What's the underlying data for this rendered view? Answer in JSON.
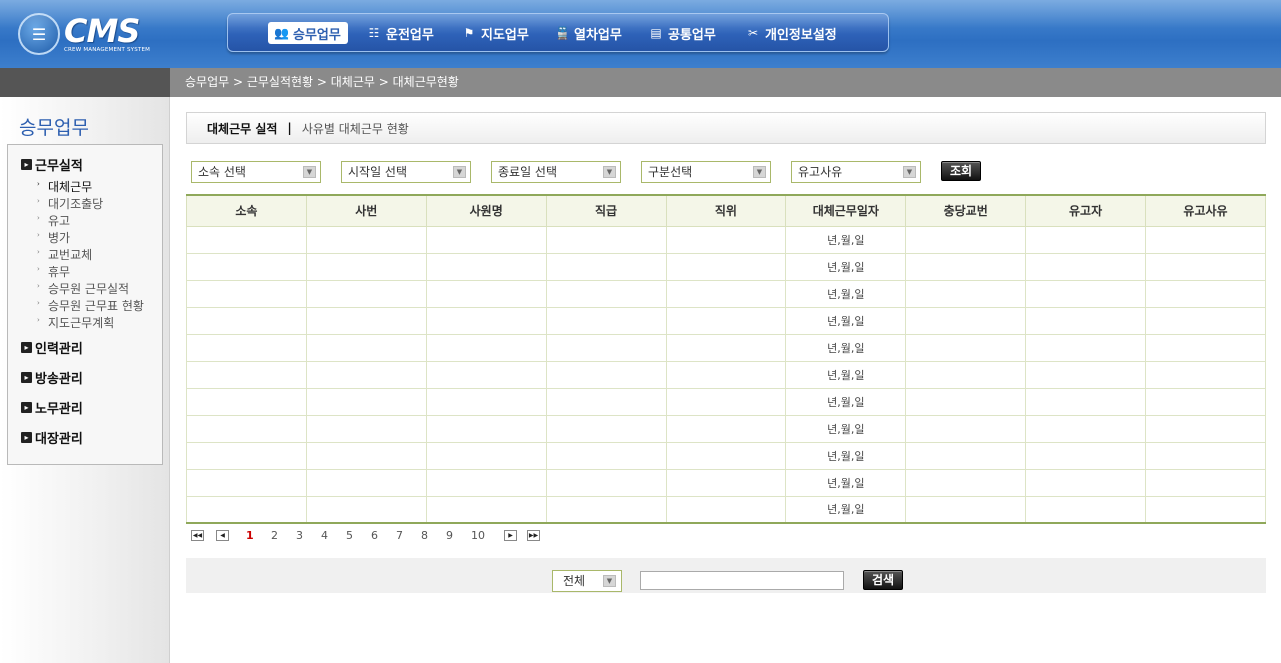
{
  "logo": {
    "badge": "☰",
    "main": "CMS",
    "sub": "CREW MANAGEMENT SYSTEM"
  },
  "topnav": [
    {
      "label": "승무업무",
      "icon": "crew-icon",
      "glyph": "👥",
      "active": true
    },
    {
      "label": "운전업무",
      "icon": "track-icon",
      "glyph": "☷",
      "active": false
    },
    {
      "label": "지도업무",
      "icon": "flag-icon",
      "glyph": "⚑",
      "active": false
    },
    {
      "label": "열차업무",
      "icon": "train-icon",
      "glyph": "🚆",
      "active": false
    },
    {
      "label": "공통업무",
      "icon": "document-icon",
      "glyph": "▤",
      "active": false
    },
    {
      "label": "개인정보설정",
      "icon": "tools-icon",
      "glyph": "✂",
      "active": false
    }
  ],
  "breadcrumb": "승무업무 > 근무실적현황 > 대체근무 > 대체근무현황",
  "sidebar": {
    "title": "승무업무",
    "sections": [
      {
        "label": "근무실적",
        "items": [
          "대체근무",
          "대기조출당",
          "유고",
          "병가",
          "교번교체",
          "휴무",
          "승무원 근무실적",
          "승무원 근무표 현황",
          "지도근무계획"
        ]
      },
      {
        "label": "인력관리"
      },
      {
        "label": "방송관리"
      },
      {
        "label": "노무관리"
      },
      {
        "label": "대장관리"
      }
    ],
    "current_item": "대체근무"
  },
  "page_header": {
    "title": "대체근무 실적",
    "separator": "|",
    "subtitle": "사유별 대체근무 현황"
  },
  "filters": {
    "affiliation": "소속 선택",
    "start_date": "시작일 선택",
    "end_date": "종료일 선택",
    "category": "구분선택",
    "reason": "유고사유",
    "submit_label": "조회"
  },
  "table": {
    "columns": [
      "소속",
      "사번",
      "사원명",
      "직급",
      "직위",
      "대체근무일자",
      "충당교번",
      "유고자",
      "유고사유"
    ],
    "rows": [
      [
        "",
        "",
        "",
        "",
        "",
        "년,월,일",
        "",
        "",
        ""
      ],
      [
        "",
        "",
        "",
        "",
        "",
        "년,월,일",
        "",
        "",
        ""
      ],
      [
        "",
        "",
        "",
        "",
        "",
        "년,월,일",
        "",
        "",
        ""
      ],
      [
        "",
        "",
        "",
        "",
        "",
        "년,월,일",
        "",
        "",
        ""
      ],
      [
        "",
        "",
        "",
        "",
        "",
        "년,월,일",
        "",
        "",
        ""
      ],
      [
        "",
        "",
        "",
        "",
        "",
        "년,월,일",
        "",
        "",
        ""
      ],
      [
        "",
        "",
        "",
        "",
        "",
        "년,월,일",
        "",
        "",
        ""
      ],
      [
        "",
        "",
        "",
        "",
        "",
        "년,월,일",
        "",
        "",
        ""
      ],
      [
        "",
        "",
        "",
        "",
        "",
        "년,월,일",
        "",
        "",
        ""
      ],
      [
        "",
        "",
        "",
        "",
        "",
        "년,월,일",
        "",
        "",
        ""
      ],
      [
        "",
        "",
        "",
        "",
        "",
        "년,월,일",
        "",
        "",
        ""
      ]
    ]
  },
  "pagination": {
    "pages": [
      "1",
      "2",
      "3",
      "4",
      "5",
      "6",
      "7",
      "8",
      "9",
      "10"
    ],
    "current": "1"
  },
  "search": {
    "scope": "전체",
    "query": "",
    "button_label": "검색"
  },
  "colors": {
    "header_blue": "#2d6fc2",
    "accent_green": "#8fa85a",
    "current_page_red": "#cc0000"
  }
}
